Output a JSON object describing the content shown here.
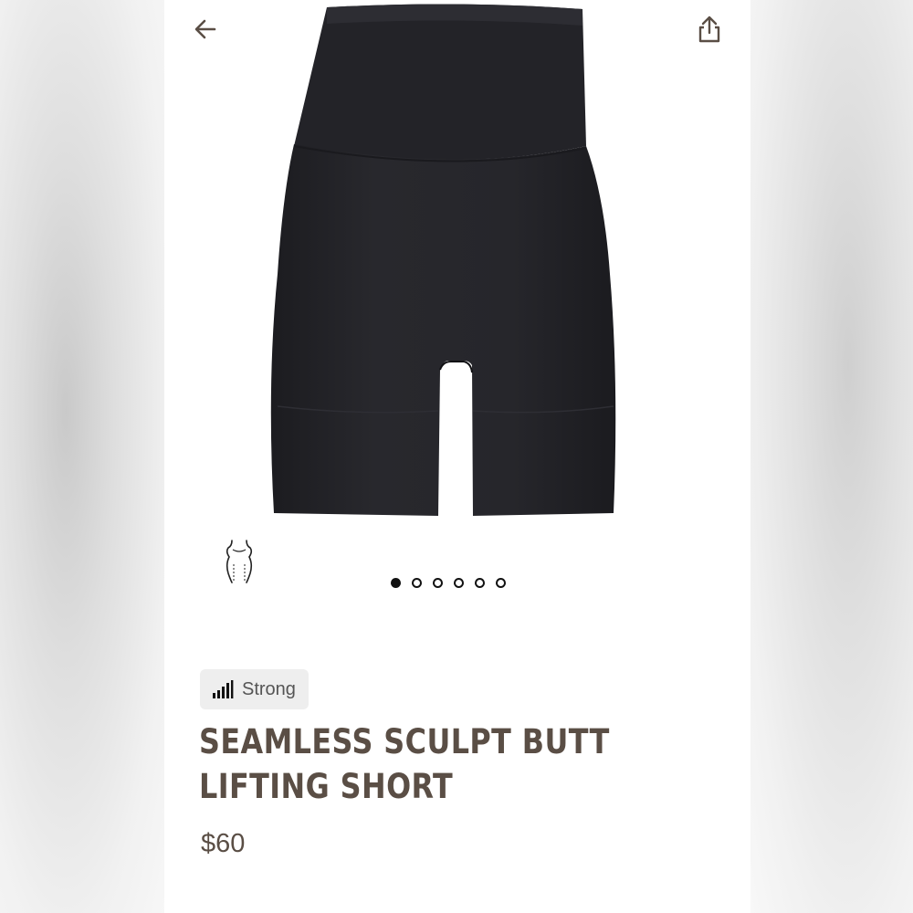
{
  "header": {
    "back_icon": "arrow-left-icon",
    "share_icon": "share-icon"
  },
  "gallery": {
    "image_alt": "black seamless shaping shorts",
    "image_count": 6,
    "active_index": 0,
    "body_shape_icon": "body-silhouette-icon"
  },
  "product": {
    "badge_icon": "signal-strength-icon",
    "compression_level": "Strong",
    "title_line1": "SEAMLESS SCULPT BUTT",
    "title_line2": "LIFTING SHORT",
    "price": "$60"
  },
  "colors": {
    "title": "#5a4e45",
    "product": "#232328",
    "badge_bg": "#eeeeee"
  }
}
